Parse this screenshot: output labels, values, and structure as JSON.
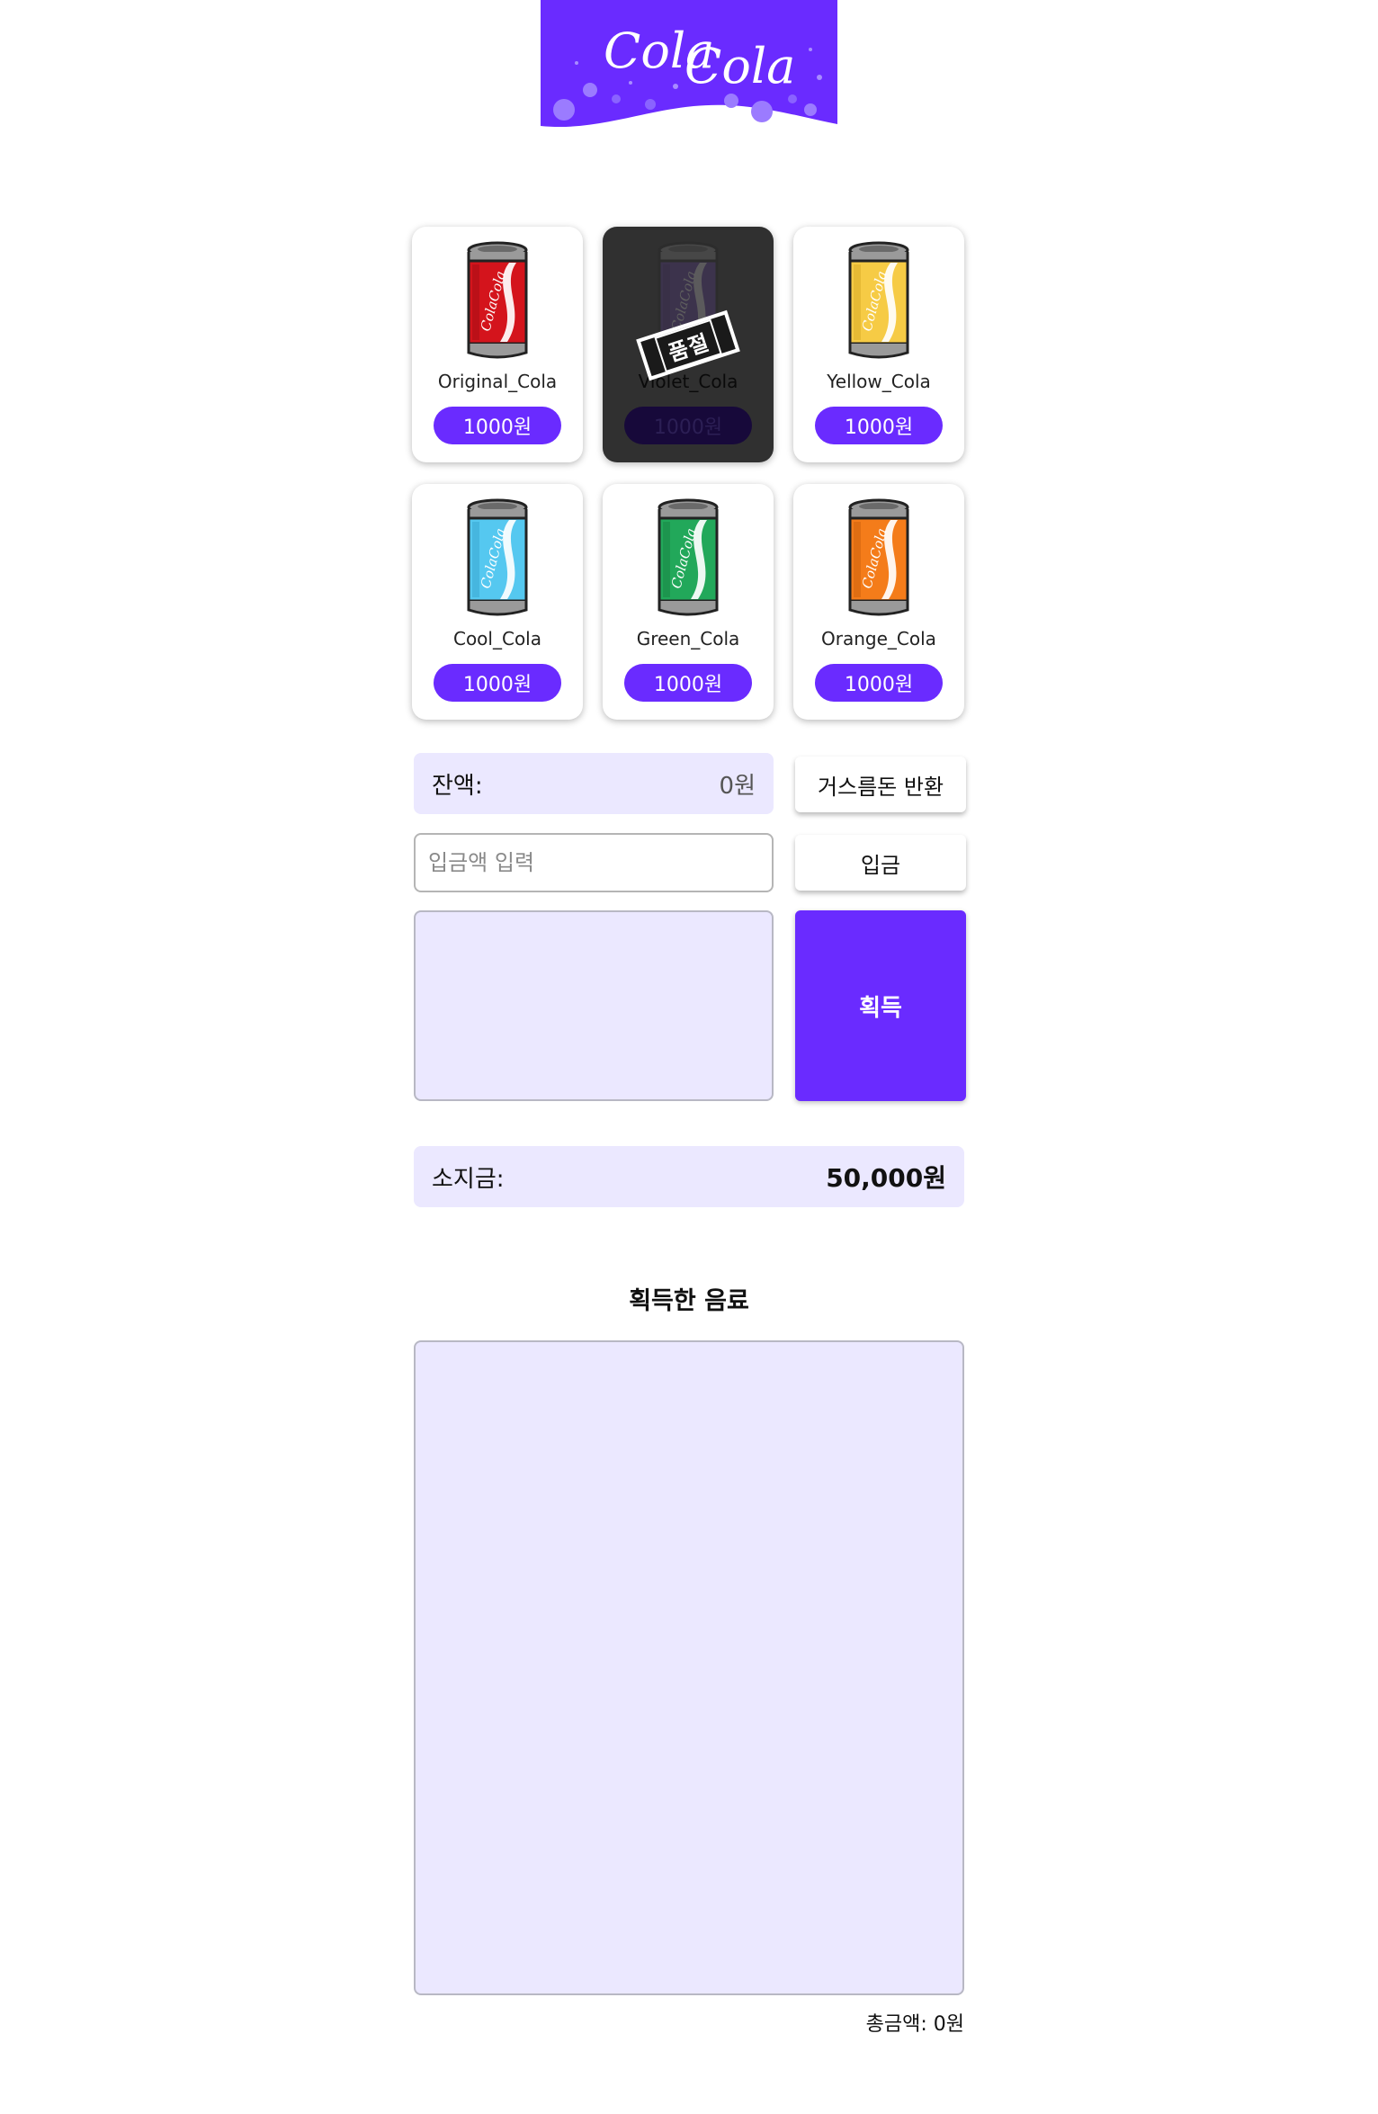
{
  "logo": {
    "text_1": "Cola",
    "text_2": "Cola",
    "color": "#6a2bff"
  },
  "products": [
    {
      "name": "Original_Cola",
      "price": "1000원",
      "color": "#d4141c",
      "dark": "#8c0a10",
      "soldout": false
    },
    {
      "name": "Violet_Cola",
      "price": "1000원",
      "color": "#6a3fb0",
      "dark": "#3c1f70",
      "soldout": true,
      "soldout_label": "품절"
    },
    {
      "name": "Yellow_Cola",
      "price": "1000원",
      "color": "#f6cb45",
      "dark": "#c99a16",
      "soldout": false
    },
    {
      "name": "Cool_Cola",
      "price": "1000원",
      "color": "#55c8f0",
      "dark": "#2a94c0",
      "soldout": false
    },
    {
      "name": "Green_Cola",
      "price": "1000원",
      "color": "#22a85a",
      "dark": "#137238",
      "soldout": false
    },
    {
      "name": "Orange_Cola",
      "price": "1000원",
      "color": "#f47c1a",
      "dark": "#b8550a",
      "soldout": false
    }
  ],
  "balance": {
    "label": "잔액:",
    "value": "0원"
  },
  "return_button": "거스름돈 반환",
  "deposit": {
    "placeholder": "입금액 입력",
    "value": "",
    "button": "입금"
  },
  "get_button": "획득",
  "wallet": {
    "label": "소지금:",
    "value": "50,000원"
  },
  "obtained": {
    "title": "획득한 음료",
    "total_label": "총금액:",
    "total_value": "0원"
  },
  "colors": {
    "accent": "#6a2bff",
    "panel": "#ebe8ff"
  }
}
